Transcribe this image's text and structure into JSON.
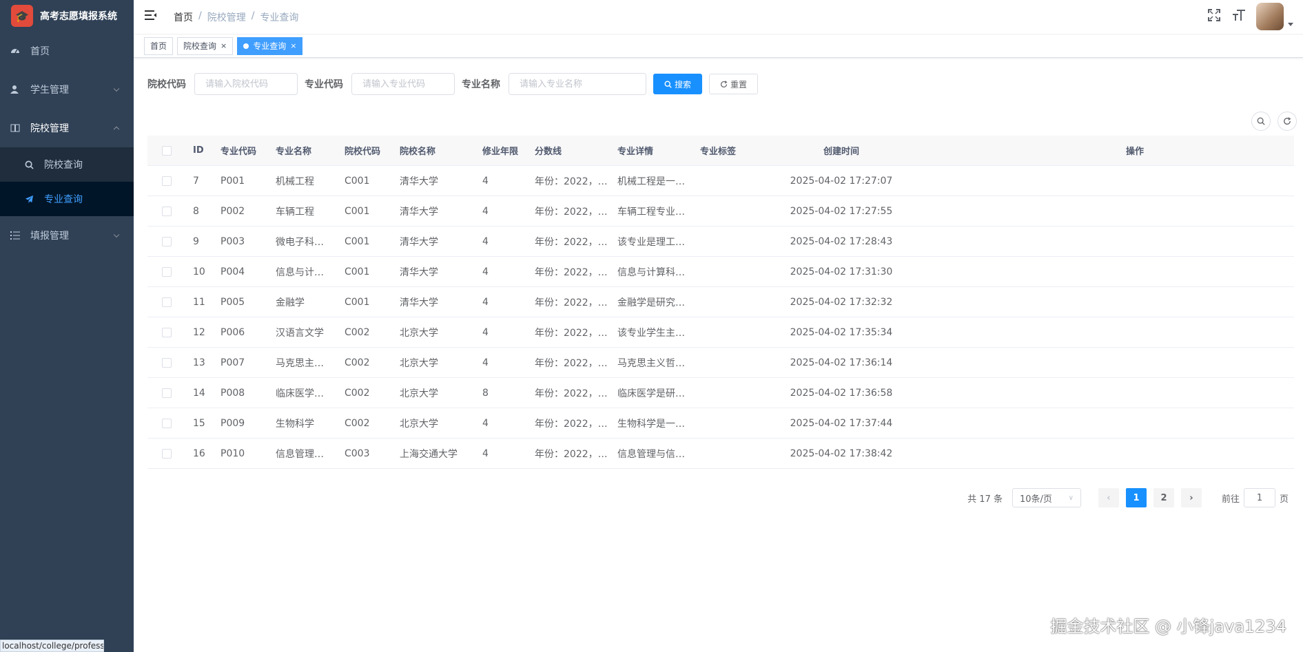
{
  "app": {
    "title": "高考志愿填报系统",
    "logo_icon": "graduation-cap-icon"
  },
  "sidebar": {
    "items": [
      {
        "label": "首页",
        "icon": "dashboard-icon"
      },
      {
        "label": "学生管理",
        "icon": "user-icon"
      },
      {
        "label": "院校管理",
        "icon": "book-icon",
        "expanded": true,
        "children": [
          {
            "label": "院校查询",
            "icon": "search-icon"
          },
          {
            "label": "专业查询",
            "icon": "paper-plane-icon",
            "active": true
          }
        ]
      },
      {
        "label": "填报管理",
        "icon": "list-icon"
      }
    ]
  },
  "status_url": "localhost/college/professio",
  "header": {
    "breadcrumb": [
      "首页",
      "院校管理",
      "专业查询"
    ],
    "icons": [
      "fullscreen-icon",
      "font-size-icon"
    ]
  },
  "tags": [
    {
      "label": "首页"
    },
    {
      "label": "院校查询",
      "close": "×"
    },
    {
      "label": "专业查询",
      "close": "×",
      "active": true
    }
  ],
  "search": {
    "college_code_label": "院校代码",
    "college_code_placeholder": "请输入院校代码",
    "major_code_label": "专业代码",
    "major_code_placeholder": "请输入专业代码",
    "major_name_label": "专业名称",
    "major_name_placeholder": "请输入专业名称",
    "search_button": "搜索",
    "reset_button": "重置"
  },
  "table": {
    "columns": [
      "ID",
      "专业代码",
      "专业名称",
      "院校代码",
      "院校名称",
      "修业年限",
      "分数线",
      "专业详情",
      "专业标签",
      "创建时间",
      "操作"
    ],
    "rows": [
      [
        "7",
        "P001",
        "机械工程",
        "C001",
        "清华大学",
        "4",
        "年份：2022，…",
        "机械工程是一…",
        "",
        "2025-04-02 17:27:07"
      ],
      [
        "8",
        "P002",
        "车辆工程",
        "C001",
        "清华大学",
        "4",
        "年份：2022，…",
        "车辆工程专业…",
        "",
        "2025-04-02 17:27:55"
      ],
      [
        "9",
        "P003",
        "微电子科…",
        "C001",
        "清华大学",
        "4",
        "年份：2022，…",
        "该专业是理工…",
        "",
        "2025-04-02 17:28:43"
      ],
      [
        "10",
        "P004",
        "信息与计…",
        "C001",
        "清华大学",
        "4",
        "年份：2022，…",
        "信息与计算科…",
        "",
        "2025-04-02 17:31:30"
      ],
      [
        "11",
        "P005",
        "金融学",
        "C001",
        "清华大学",
        "4",
        "年份：2022，…",
        "金融学是研究…",
        "",
        "2025-04-02 17:32:32"
      ],
      [
        "12",
        "P006",
        "汉语言文学",
        "C002",
        "北京大学",
        "4",
        "年份：2022，…",
        "该专业学生主…",
        "",
        "2025-04-02 17:35:34"
      ],
      [
        "13",
        "P007",
        "马克思主…",
        "C002",
        "北京大学",
        "4",
        "年份：2022，…",
        "马克思主义哲…",
        "",
        "2025-04-02 17:36:14"
      ],
      [
        "14",
        "P008",
        "临床医学…",
        "C002",
        "北京大学",
        "8",
        "年份：2022，…",
        "临床医学是研…",
        "",
        "2025-04-02 17:36:58"
      ],
      [
        "15",
        "P009",
        "生物科学",
        "C002",
        "北京大学",
        "4",
        "年份：2022，…",
        "生物科学是一…",
        "",
        "2025-04-02 17:37:44"
      ],
      [
        "16",
        "P010",
        "信息管理…",
        "C003",
        "上海交通大学",
        "4",
        "年份：2022，…",
        "信息管理与信…",
        "",
        "2025-04-02 17:38:42"
      ]
    ]
  },
  "pagination": {
    "total_text": "共 17 条",
    "page_size": "10条/页",
    "pages": [
      "1",
      "2"
    ],
    "current": "1",
    "goto_label": "前往",
    "goto_value": "1",
    "page_suffix": "页"
  },
  "watermark": "掘金技术社区 @ 小锋java1234"
}
